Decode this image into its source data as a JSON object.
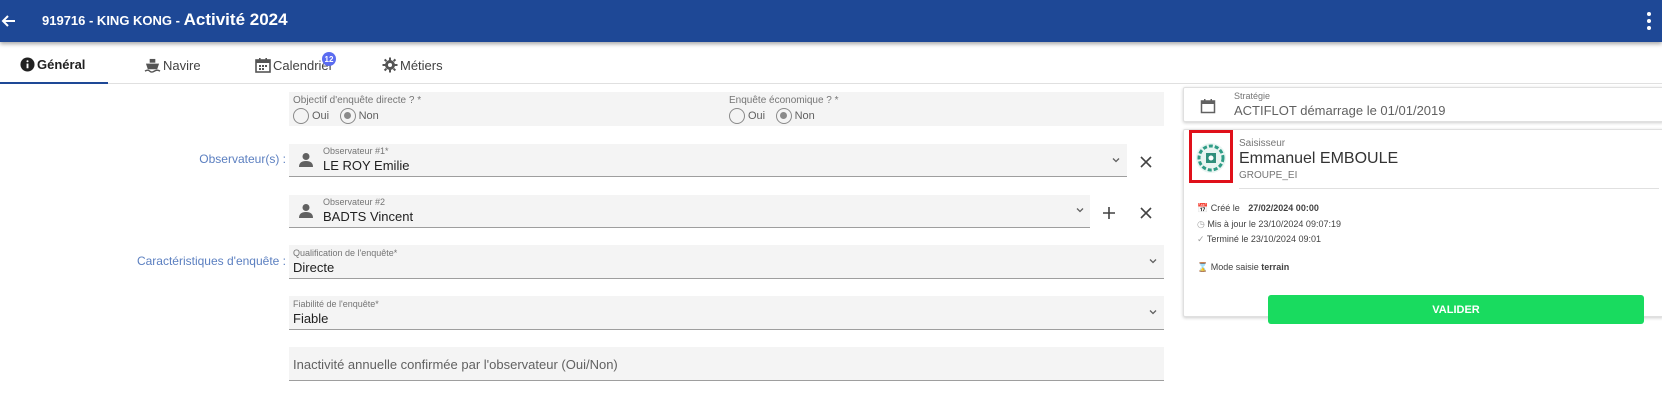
{
  "header": {
    "prefix": "919716 - KING KONG - ",
    "title": "Activité 2024"
  },
  "tabs": [
    {
      "label": "Général"
    },
    {
      "label": "Navire"
    },
    {
      "label": "Calendrier",
      "badge": "12"
    },
    {
      "label": "Métiers"
    }
  ],
  "survey": {
    "direct_label": "Objectif d'enquête directe ? *",
    "direct_options": [
      "Oui",
      "Non"
    ],
    "direct_selected": "Non",
    "eco_label": "Enquête économique ? *",
    "eco_options": [
      "Oui",
      "Non"
    ],
    "eco_selected": "Non"
  },
  "observers": {
    "section_label": "Observateur(s) :",
    "obs1_label": "Observateur #1*",
    "obs1_value": "LE ROY Emilie",
    "obs2_label": "Observateur #2",
    "obs2_value": "BADTS Vincent"
  },
  "characteristics": {
    "section_label": "Caractéristiques d'enquête :",
    "qualification_label": "Qualification de l'enquête*",
    "qualification_value": "Directe",
    "fiabilite_label": "Fiabilité de l'enquête*",
    "fiabilite_value": "Fiable",
    "inactivity_placeholder": "Inactivité annuelle confirmée par l'observateur (Oui/Non)"
  },
  "strategy": {
    "label": "Stratégie",
    "value": "ACTIFLOT démarrage le 01/01/2019"
  },
  "entry": {
    "label": "Saisisseur",
    "name": "Emmanuel EMBOULE",
    "group": "GROUPE_EI",
    "created_prefix": "Créé le",
    "created_value": "27/02/2024 00:00",
    "updated": "Mis à jour le 23/10/2024 09:07:19",
    "finished": "Terminé le 23/10/2024 09:01",
    "mode_prefix": "Mode saisie",
    "mode_value": "terrain",
    "validate_label": "VALIDER"
  },
  "colors": {
    "header_bg": "#1e4896",
    "accent_label": "#5b7fc0",
    "validate_bg": "#19db5f",
    "badge_bg": "#5b6cf0",
    "highlight": "#e0101a"
  }
}
